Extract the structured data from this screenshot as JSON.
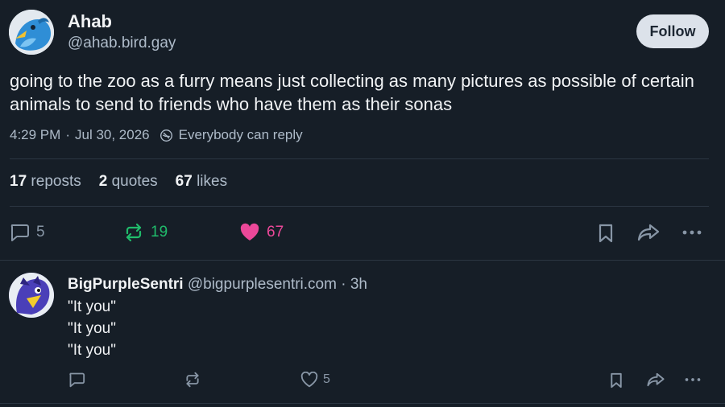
{
  "post": {
    "author": {
      "name": "Ahab",
      "handle": "@ahab.bird.gay"
    },
    "follow_label": "Follow",
    "text": "going to the zoo as a furry means just collecting as many pictures as possible of certain animals to send to friends who have them as their sonas",
    "time": "4:29 PM",
    "date": "Jul 30, 2026",
    "reply_setting": "Everybody can reply",
    "stats": {
      "reposts_count": "17",
      "reposts_label": "reposts",
      "quotes_count": "2",
      "quotes_label": "quotes",
      "likes_count": "67",
      "likes_label": "likes"
    },
    "actions": {
      "replies": "5",
      "reposts": "19",
      "likes": "67"
    }
  },
  "reply": {
    "name": "BigPurpleSentri",
    "handle": "@bigpurplesentri.com",
    "age": "3h",
    "lines": [
      "\"It you\"",
      "\"It you\"",
      "\"It you\""
    ],
    "actions": {
      "likes": "5"
    }
  },
  "colors": {
    "background": "#161e27",
    "repost_active": "#20bc6b",
    "like_active": "#ec4899",
    "muted": "#aebbc9"
  },
  "icons": [
    "reply-icon",
    "repost-icon",
    "heart-icon",
    "bookmark-icon",
    "share-icon",
    "more-icon",
    "globe-icon"
  ]
}
